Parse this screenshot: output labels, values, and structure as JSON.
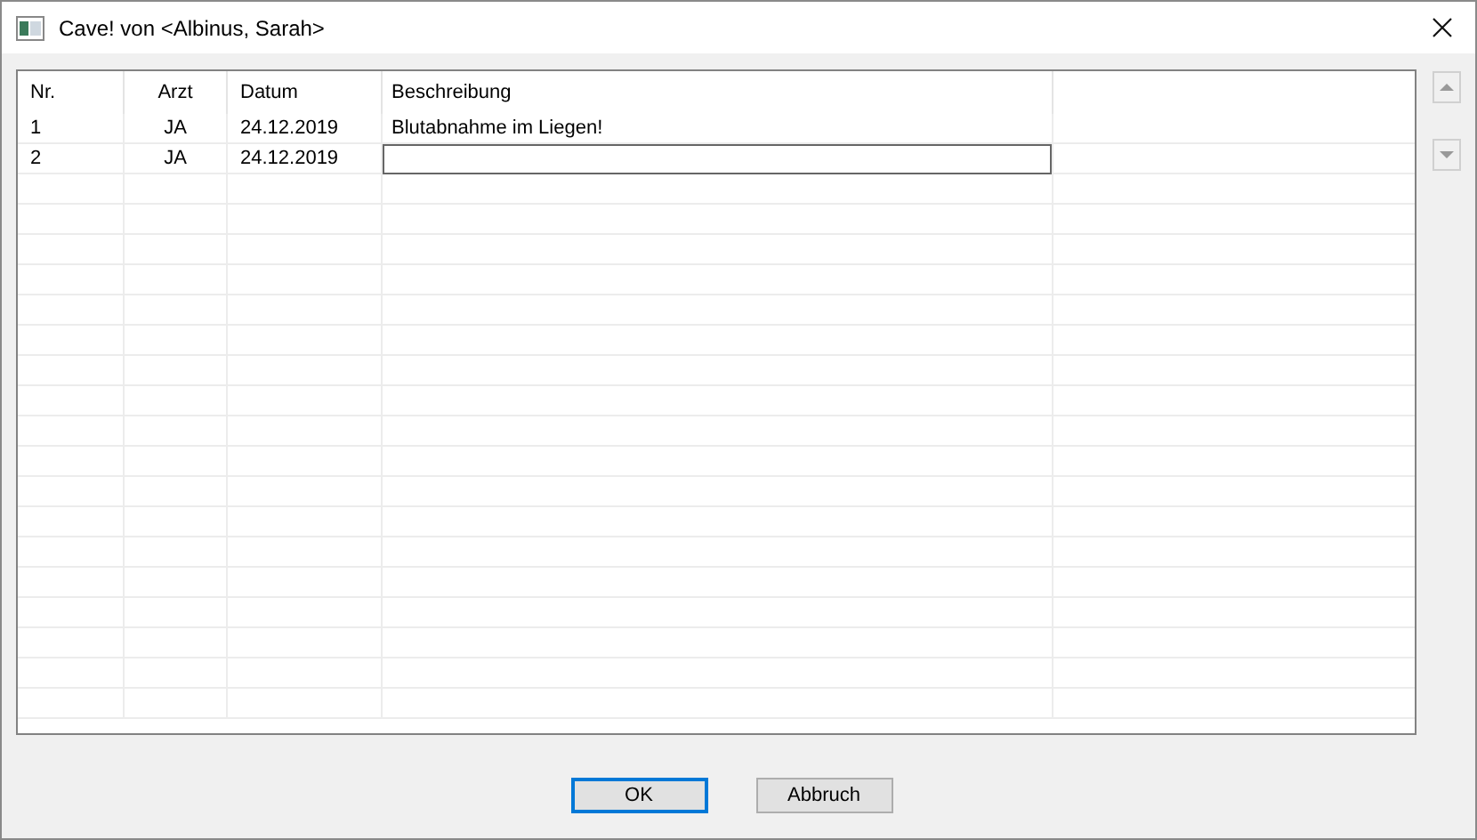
{
  "window": {
    "title": "Cave! von <Albinus, Sarah>"
  },
  "table": {
    "columns": [
      "Nr.",
      "Arzt",
      "Datum",
      "Beschreibung"
    ],
    "rows": [
      {
        "cells": [
          "1",
          "JA",
          "24.12.2019",
          "Blutabnahme im Liegen!"
        ],
        "editing": false
      },
      {
        "cells": [
          "2",
          "JA",
          "24.12.2019",
          ""
        ],
        "editing": true
      }
    ]
  },
  "buttons": [
    {
      "label": "OK",
      "default": true
    },
    {
      "label": "Abbruch",
      "default": false
    }
  ]
}
